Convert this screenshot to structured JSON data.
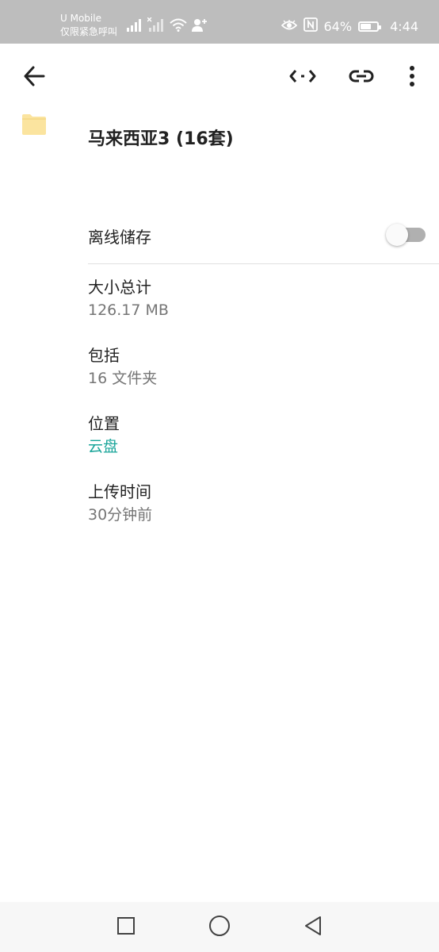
{
  "status_bar": {
    "carrier": "U Mobile",
    "carrier_sub": "仅限紧急呼叫",
    "battery_text": "64%",
    "battery_level": 0.64,
    "time": "4:44",
    "icons": [
      "signal-icon",
      "no-signal-icon",
      "wifi-icon",
      "person-add-icon",
      "eye-icon",
      "nfc-icon",
      "battery-icon"
    ]
  },
  "app_bar": {
    "icons": [
      "back-arrow-icon",
      "resize-arrows-icon",
      "link-icon",
      "more-vert-icon"
    ]
  },
  "folder": {
    "icon": "folder-icon",
    "title": "马来西亚3 (16套)"
  },
  "offline": {
    "label": "离线储存",
    "enabled": false
  },
  "details": [
    {
      "label": "大小总计",
      "value": "126.17 MB"
    },
    {
      "label": "包括",
      "value": "16 文件夹"
    },
    {
      "label": "位置",
      "value": "云盘"
    },
    {
      "label": "上传时间",
      "value": "30分钟前"
    }
  ],
  "nav_bar": {
    "icons": [
      "recent-apps-icon",
      "home-icon",
      "back-icon"
    ]
  },
  "colors": {
    "status_bar": "#bdbdbd",
    "accent": "#1aa59a",
    "folder": "#fbe49f"
  }
}
